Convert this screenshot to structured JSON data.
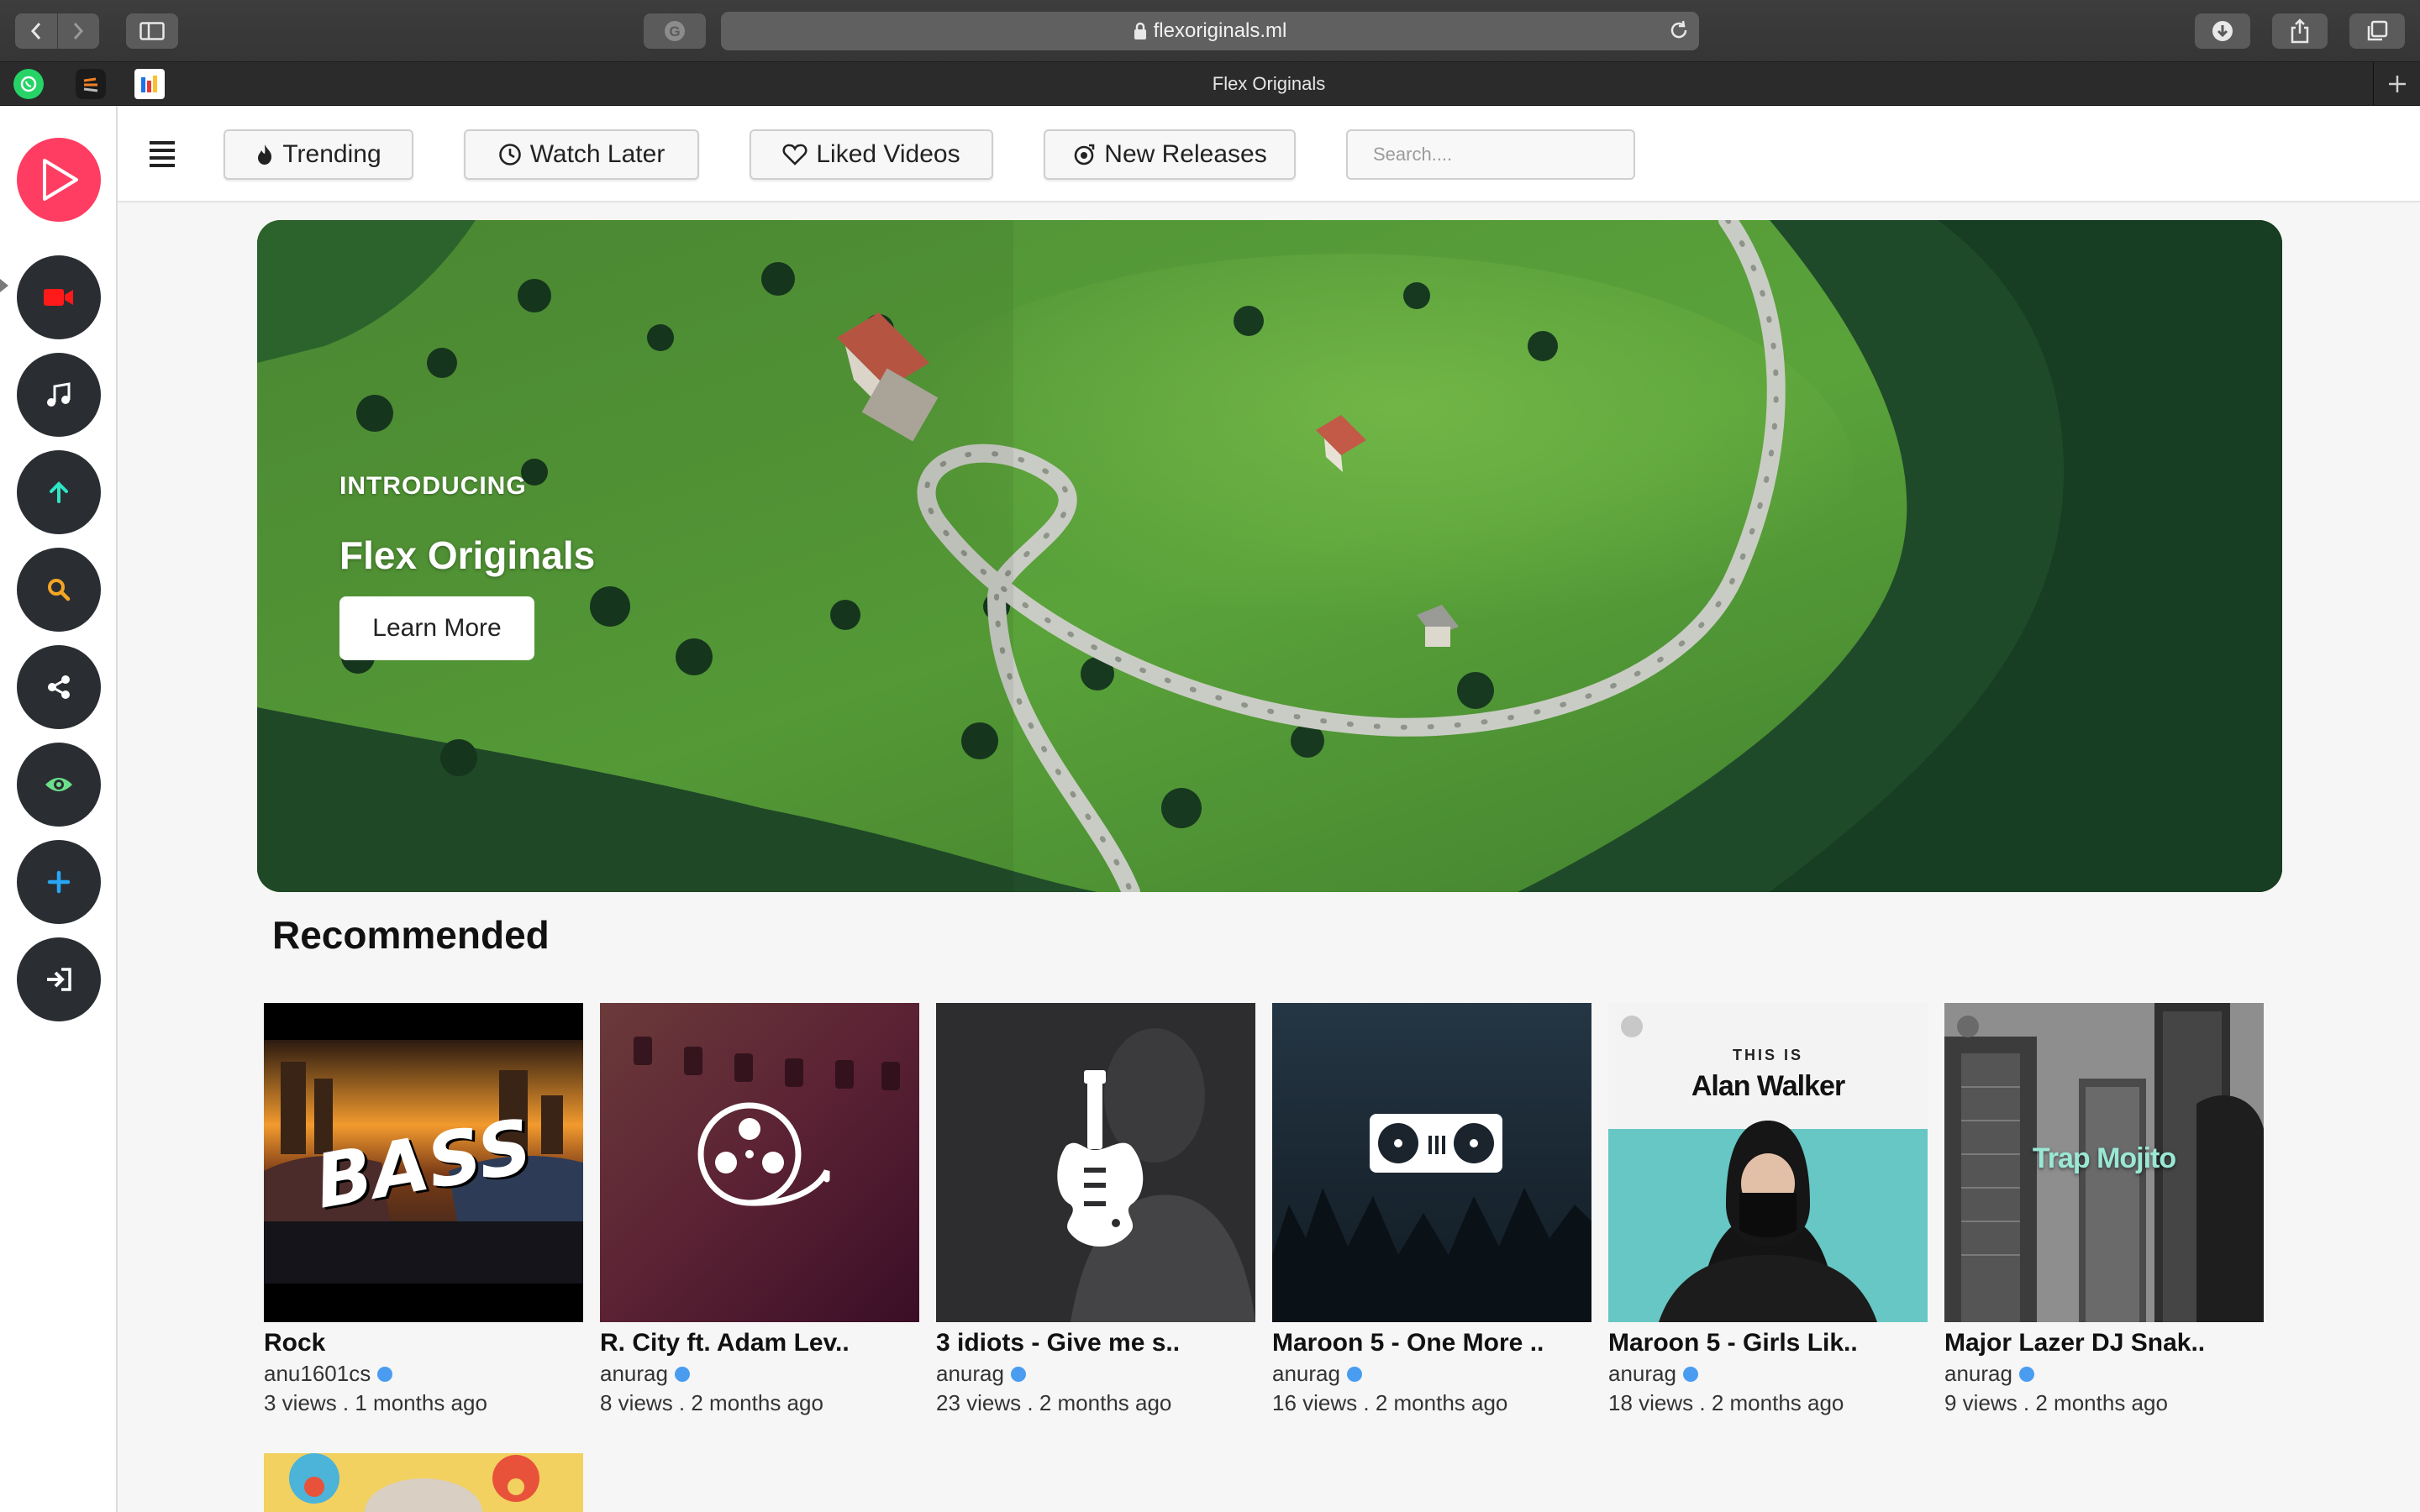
{
  "browser": {
    "url": "flexoriginals.ml",
    "tab_title": "Flex Originals"
  },
  "topnav": {
    "chips": [
      {
        "label": "Trending",
        "icon": "fire-icon"
      },
      {
        "label": "Watch Later",
        "icon": "clock-icon"
      },
      {
        "label": "Liked Videos",
        "icon": "heart-icon"
      },
      {
        "label": "New Releases",
        "icon": "new-releases-icon"
      }
    ],
    "search_placeholder": "Search...."
  },
  "sidebar": {
    "items": [
      {
        "icon": "play-logo-icon",
        "color": "#ff3d62"
      },
      {
        "icon": "video-camera-icon",
        "color": "#ff1a1a"
      },
      {
        "icon": "music-note-icon",
        "color": "#ffffff"
      },
      {
        "icon": "upload-arrow-icon",
        "color": "#2ee6c4"
      },
      {
        "icon": "search-icon",
        "color": "#f5a623"
      },
      {
        "icon": "share-icon",
        "color": "#ffffff"
      },
      {
        "icon": "eye-icon",
        "color": "#6be08a"
      },
      {
        "icon": "plus-icon",
        "color": "#27a7f5"
      },
      {
        "icon": "sign-in-icon",
        "color": "#ffffff"
      }
    ]
  },
  "hero": {
    "kicker": "INTRODUCING",
    "title": "Flex Originals",
    "button": "Learn More"
  },
  "recommended": {
    "title": "Recommended",
    "cards": [
      {
        "title": "Rock",
        "channel": "anu1601cs",
        "meta": "3 views . 1 months ago",
        "thumb_text": "BASS"
      },
      {
        "title": "R. City ft. Adam Lev..",
        "channel": "anurag",
        "meta": "8 views . 2 months ago",
        "thumb_text": ""
      },
      {
        "title": "3 idiots - Give me s..",
        "channel": "anurag",
        "meta": "23 views . 2 months ago",
        "thumb_text": ""
      },
      {
        "title": "Maroon 5 - One More ..",
        "channel": "anurag",
        "meta": "16 views . 2 months ago",
        "thumb_text": ""
      },
      {
        "title": "Maroon 5 - Girls Lik..",
        "channel": "anurag",
        "meta": "18 views . 2 months ago",
        "thumb_text": "Alan Walker",
        "thumb_kicker": "THIS IS"
      },
      {
        "title": "Major Lazer DJ Snak..",
        "channel": "anurag",
        "meta": "9 views . 2 months ago",
        "thumb_text": "Trap Mojito"
      }
    ]
  },
  "colors": {
    "brand": "#ff3d62",
    "sidebar_button": "#2a2e33",
    "verified": "#4a9cf0"
  }
}
